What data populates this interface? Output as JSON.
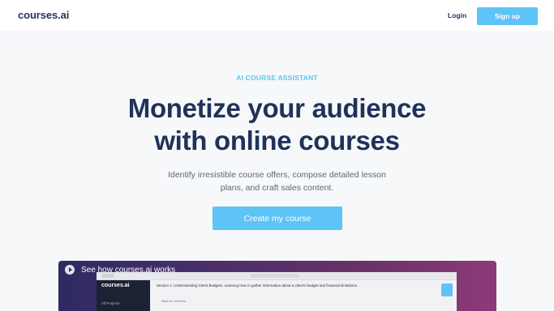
{
  "header": {
    "logo_text": "courses.ai",
    "login_label": "Login",
    "signup_label": "Sign up"
  },
  "hero": {
    "eyebrow": "AI COURSE ASSISTANT",
    "headline_line1": "Monetize your audience",
    "headline_line2": "with online courses",
    "subtitle_line1": "Identify irresistible course offers, compose detailed lesson",
    "subtitle_line2": "plans, and craft sales content.",
    "cta_label": "Create my course"
  },
  "video": {
    "title": "See how courses.ai works",
    "app_logo": "courses.ai",
    "app_sidebar_item": "All Projects",
    "app_content_text": "Section 1: Understanding Client Budgets: Learning how to gather information about a client's budget and financial limitations.",
    "app_content_sub": "Back to overview"
  },
  "colors": {
    "brand_navy": "#1f3259",
    "accent_blue": "#5ec3f6",
    "background": "#f7f8fa"
  }
}
